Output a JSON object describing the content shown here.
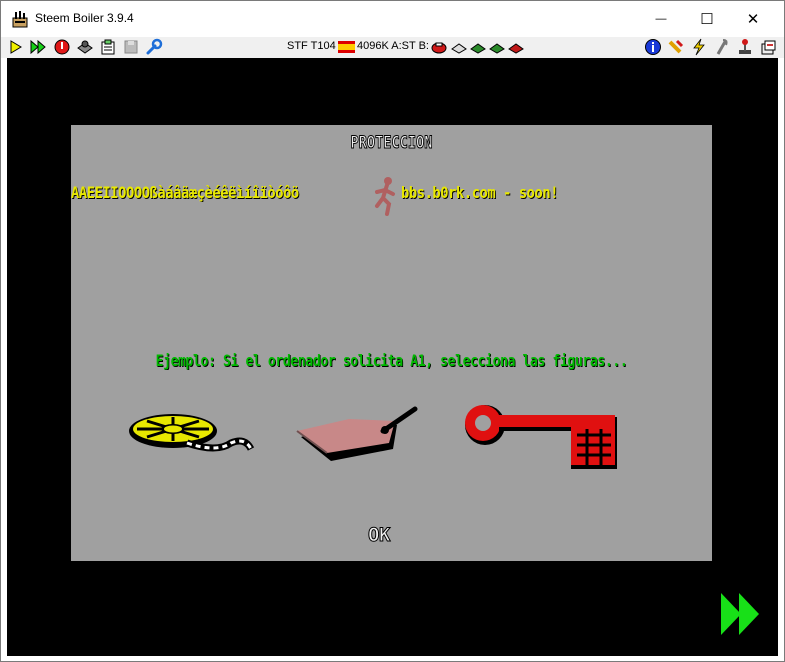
{
  "window": {
    "title": "Steem Boiler 3.9.4",
    "minimize_glyph": "—",
    "maximize_glyph": "☐",
    "close_glyph": "✕"
  },
  "toolbar": {
    "left_icons": [
      "play-icon",
      "fast-forward-icon",
      "reset-icon",
      "snapshot-icon",
      "paste-icon",
      "disk-manager-icon",
      "wrench-icon"
    ],
    "status_text": "STF T104",
    "memory_text": "4096K A:ST B:",
    "right_icons": [
      "info-icon",
      "shortcuts-icon",
      "lightning-icon",
      "patches-icon",
      "joystick-icon",
      "options-icon"
    ]
  },
  "dialog": {
    "title": "PROTECCION",
    "charset_text": "AAEEIIOOOOßàáâäæçèéêëìíîïòóôö",
    "bbs_text": "bbs.b0rk.com - soon!",
    "example_text": "Ejemplo: Si el ordenador solicita A1, selecciona las figuras...",
    "figures": [
      "film-reel-icon",
      "tag-icon",
      "key-icon"
    ],
    "ok_label": "OK"
  },
  "colors": {
    "screen_bg": "#000000",
    "dialog_bg": "#a0a0a0",
    "yellow_text": "#e8e800",
    "green_text": "#00b800",
    "fast_forward": "#18e018"
  }
}
